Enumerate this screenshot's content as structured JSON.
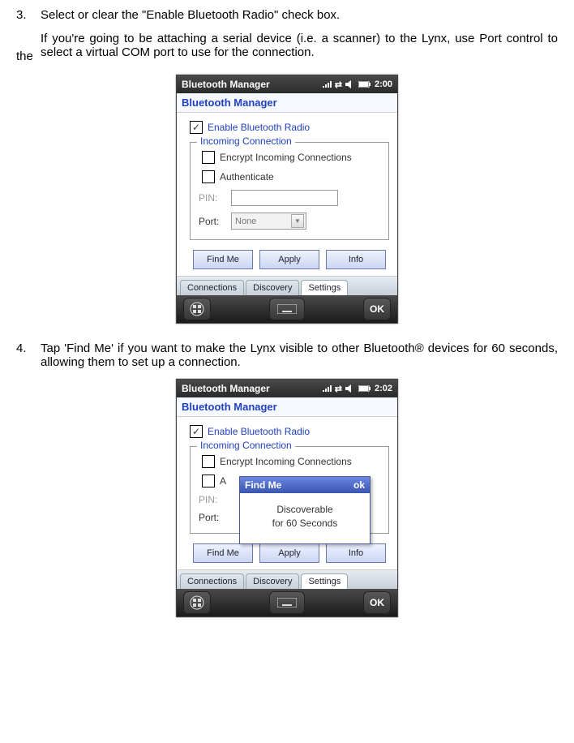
{
  "step3": {
    "num": "3.",
    "text": "Select or clear the \"Enable Bluetooth Radio\" check box."
  },
  "para_if": {
    "left_the": "the",
    "text": "If you're going to be attaching a serial device (i.e. a scanner) to the Lynx, use Port control to select a virtual COM port to use for the connection."
  },
  "step4": {
    "num": "4.",
    "text": "Tap 'Find Me' if you want to make the Lynx visible to other Bluetooth® devices for 60 seconds, allowing them to set up a connection."
  },
  "shot1": {
    "status": {
      "title": "Bluetooth Manager",
      "time": "2:00"
    },
    "title": "Bluetooth Manager",
    "enable": "Enable Bluetooth Radio",
    "legend": "Incoming Connection",
    "encrypt": "Encrypt Incoming Connections",
    "auth": "Authenticate",
    "pin": "PIN:",
    "port": "Port:",
    "port_value": "None",
    "buttons": {
      "find": "Find Me",
      "apply": "Apply",
      "info": "Info"
    },
    "tabs": {
      "connections": "Connections",
      "discovery": "Discovery",
      "settings": "Settings"
    },
    "ok": "OK"
  },
  "shot2": {
    "status": {
      "title": "Bluetooth Manager",
      "time": "2:02"
    },
    "title": "Bluetooth Manager",
    "enable": "Enable Bluetooth Radio",
    "legend": "Incoming Connection",
    "encrypt": "Encrypt Incoming Connections",
    "auth_initial": "A",
    "pin": "PIN:",
    "port": "Port:",
    "popup": {
      "title": "Find Me",
      "ok": "ok",
      "line1": "Discoverable",
      "line2": "for 60 Seconds"
    },
    "buttons": {
      "find": "Find Me",
      "apply": "Apply",
      "info": "Info"
    },
    "tabs": {
      "connections": "Connections",
      "discovery": "Discovery",
      "settings": "Settings"
    },
    "ok": "OK"
  }
}
